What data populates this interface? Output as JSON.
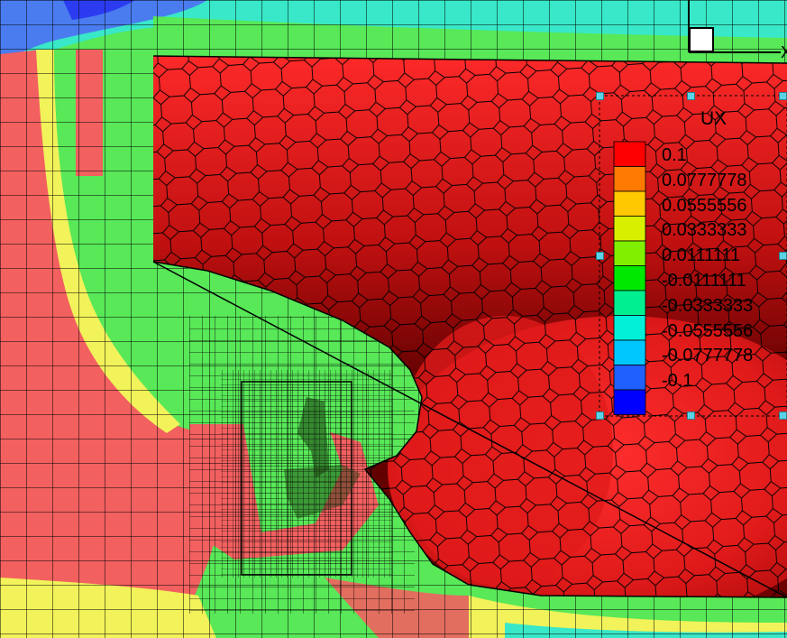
{
  "legend": {
    "title": "UX",
    "levels": [
      "0.1",
      "0.0777778",
      "0.0555556",
      "0.0333333",
      "0.0111111",
      "-0.0111111",
      "-0.0333333",
      "-0.0555556",
      "-0.0777778",
      "-0.1"
    ],
    "colors": [
      "#ff0000",
      "#ff7a00",
      "#ffc800",
      "#d8f000",
      "#80f000",
      "#00e800",
      "#00f090",
      "#00f0d8",
      "#00c8ff",
      "#2060ff",
      "#0000ff"
    ]
  },
  "axis": {
    "x_label": "X"
  },
  "palette": {
    "hull_light": "#ff2a2a",
    "hull_mid": "#d01818",
    "hull_dark": "#5a0000",
    "field_red": "#f26060",
    "field_green": "#58e858",
    "field_yellow": "#f2f25a",
    "field_cyan": "#38e8c8",
    "field_blue": "#4a7cf0",
    "mesh_line": "#000000",
    "handle": "#5ad3e6"
  }
}
